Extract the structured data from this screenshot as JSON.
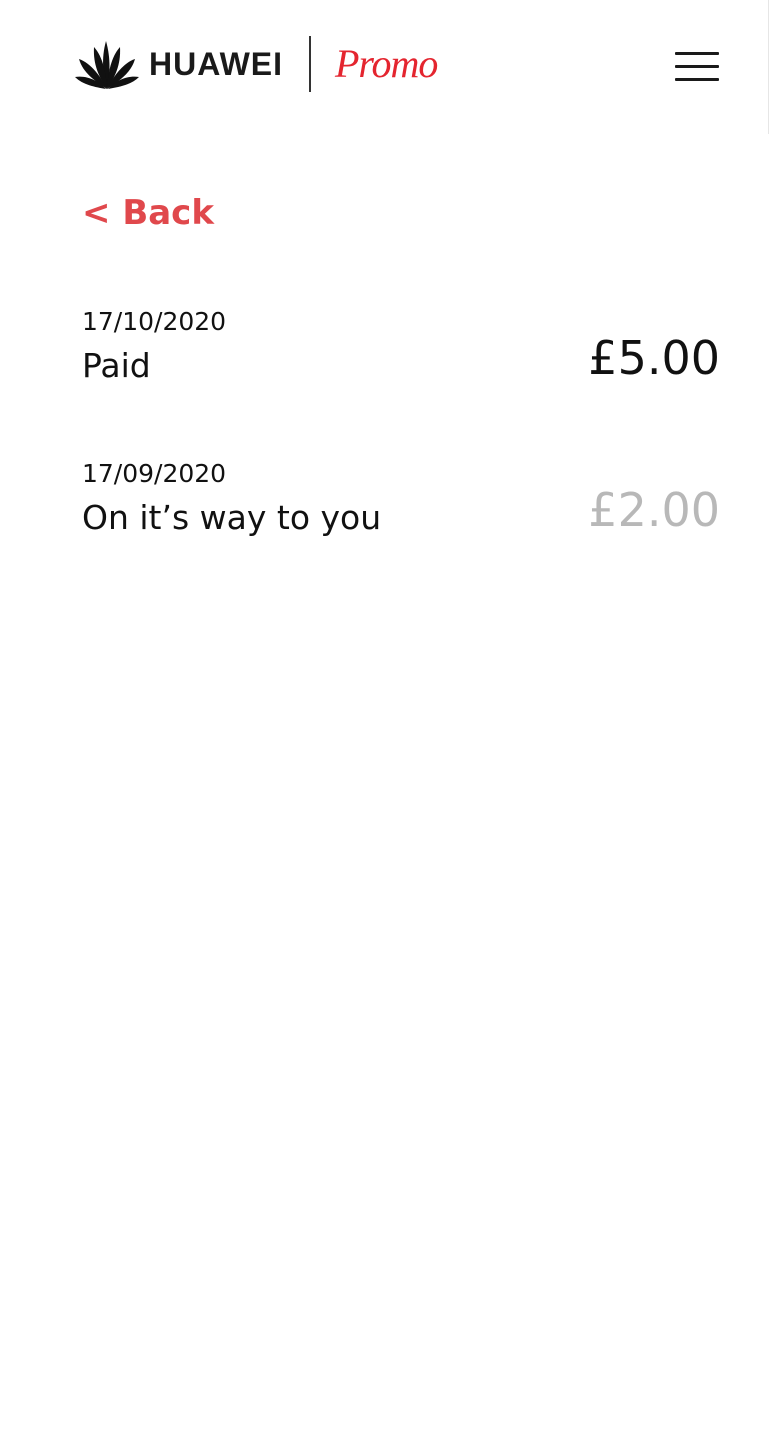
{
  "header": {
    "brand_name": "HUAWEI",
    "promo_label": "Promo",
    "menu_icon": "hamburger-menu-icon"
  },
  "nav": {
    "back_label": "< Back"
  },
  "payments": [
    {
      "date": "17/10/2020",
      "status": "Paid",
      "amount": "£5.00",
      "amount_color": "#111111"
    },
    {
      "date": "17/09/2020",
      "status": "On it’s way to you",
      "amount": "£2.00",
      "amount_color": "#b8b8b8"
    }
  ],
  "colors": {
    "accent": "#e0484c",
    "promo_red": "#e4252f",
    "text": "#111111",
    "muted_amount": "#b8b8b8"
  }
}
